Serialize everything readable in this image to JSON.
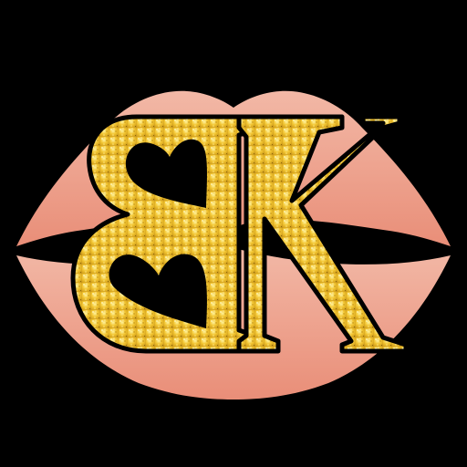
{
  "logo": {
    "monogram": "BK",
    "colors": {
      "background": "#000000",
      "lips_light": "#F2B8A6",
      "lips_dark": "#E98E78",
      "mouth_line": "#000000",
      "gold_light": "#FFF08A",
      "gold_mid": "#F2C531",
      "gold_dark": "#B8860B",
      "outline": "#000000"
    }
  }
}
